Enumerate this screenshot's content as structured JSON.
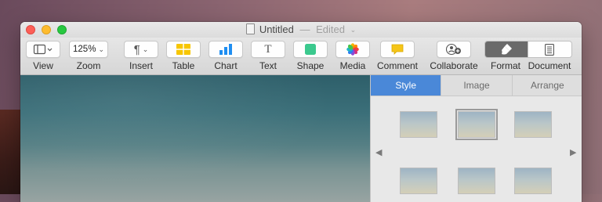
{
  "window": {
    "title": "Untitled",
    "title_separator": "—",
    "title_status": "Edited",
    "title_chevron": "⌄"
  },
  "toolbar": {
    "view": {
      "label": "View",
      "icon": "sidebar-view-icon"
    },
    "zoom": {
      "label": "Zoom",
      "value": "125%",
      "chevron": "⌄"
    },
    "insert": {
      "label": "Insert",
      "icon": "paragraph-icon",
      "glyph": "¶",
      "chevron": "⌄"
    },
    "table": {
      "label": "Table",
      "icon": "table-icon"
    },
    "chart": {
      "label": "Chart",
      "icon": "bar-chart-icon"
    },
    "text": {
      "label": "Text",
      "icon": "text-box-icon",
      "glyph": "T"
    },
    "shape": {
      "label": "Shape",
      "icon": "shape-icon"
    },
    "media": {
      "label": "Media",
      "icon": "media-flower-icon"
    },
    "comment": {
      "label": "Comment",
      "icon": "comment-icon"
    },
    "collaborate": {
      "label": "Collaborate",
      "icon": "collaborate-icon"
    },
    "format": {
      "label": "Format",
      "icon": "paintbrush-icon"
    },
    "document": {
      "label": "Document",
      "icon": "document-icon"
    }
  },
  "colors": {
    "accent_blue": "#4a88d8",
    "table_yellow": "#f7c600",
    "chart_blue": "#1f8ef1",
    "shape_green": "#3bc98e",
    "comment_yellow": "#f5c518"
  },
  "inspector": {
    "tabs": [
      {
        "label": "Style",
        "active": true
      },
      {
        "label": "Image",
        "active": false
      },
      {
        "label": "Arrange",
        "active": false
      }
    ],
    "prev_arrow": "◀",
    "next_arrow": "▶"
  }
}
